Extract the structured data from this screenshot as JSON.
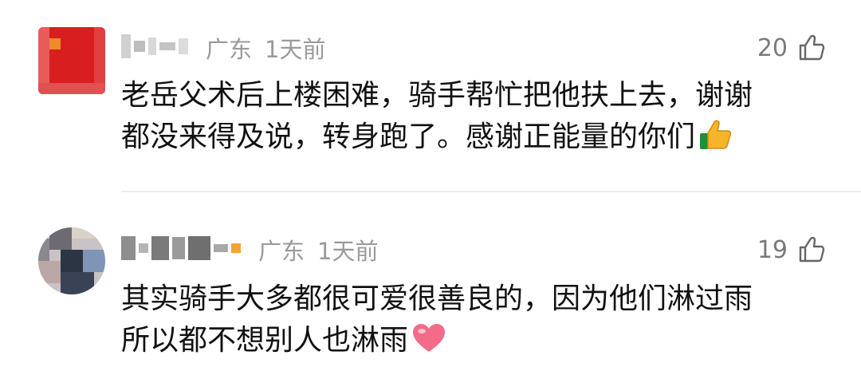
{
  "comments": [
    {
      "location": "广东",
      "time": "1天前",
      "likes": "20",
      "text_line1": "老岳父术后上楼困难，骑手帮忙把他扶上去，谢谢",
      "text_line2": "都没来得及说，转身跑了。感谢正能量的你们",
      "emoji": "thumbs-up-emoji"
    },
    {
      "location": "广东",
      "time": "1天前",
      "likes": "19",
      "text_line1": "其实骑手大多都很可爱很善良的，因为他们淋过雨",
      "text_line2": "所以都不想别人也淋雨",
      "emoji": "heart-emoji"
    }
  ],
  "icons": {
    "like": "thumb-up-outline-icon"
  },
  "colors": {
    "meta_gray": "#9a9a9a",
    "divider": "#ececec",
    "flag_red": "#d81e1e"
  }
}
